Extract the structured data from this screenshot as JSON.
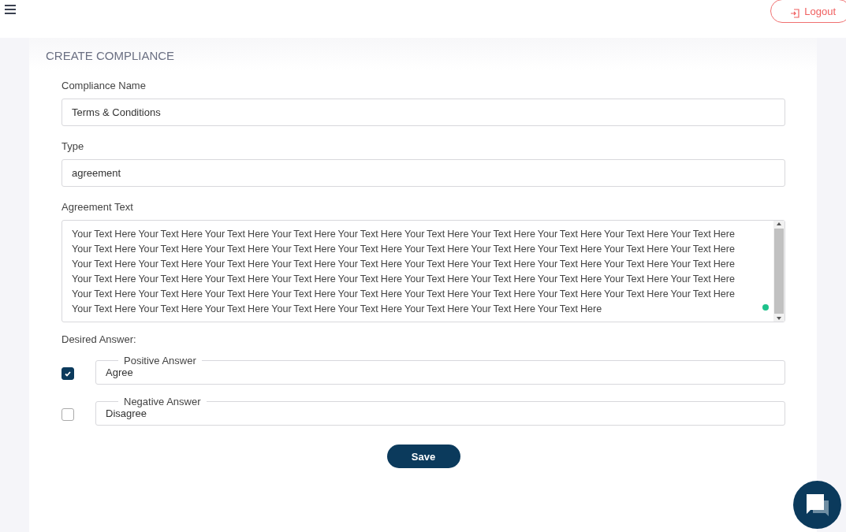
{
  "header": {
    "logout": "Logout"
  },
  "form": {
    "title": "CREATE COMPLIANCE",
    "fields": [
      {
        "label": "Compliance Name",
        "value": "Terms & Conditions"
      },
      {
        "label": "Type",
        "value": "agreement"
      }
    ],
    "agreement": {
      "label": "Agreement Text",
      "value": "Your Text Here Your Text Here Your Text Here Your Text Here Your Text Here Your Text Here Your Text Here Your Text Here Your Text Here Your Text Here Your Text Here Your Text Here Your Text Here Your Text Here Your Text Here Your Text Here Your Text Here Your Text Here Your Text Here Your Text Here Your Text Here Your Text Here Your Text Here Your Text Here Your Text Here Your Text Here Your Text Here Your Text Here Your Text Here Your Text Here Your Text Here Your Text Here Your Text Here Your Text Here Your Text Here Your Text Here Your Text Here Your Text Here Your Text Here Your Text Here Your Text Here Your Text Here Your Text Here Your Text Here Your Text Here Your Text Here Your Text Here Your Text Here Your Text Here Your Text Here Your Text Here Your Text Here Your Text Here Your Text Here Your Text Here Your Text Here Your Text Here Your Text Here"
    },
    "desired_answer": {
      "label": "Desired Answer:",
      "answers": [
        {
          "label": "Positive Answer",
          "value": "Agree",
          "checked": true
        },
        {
          "label": "Negative Answer",
          "value": "Disagree",
          "checked": false
        }
      ]
    },
    "save": "Save"
  }
}
